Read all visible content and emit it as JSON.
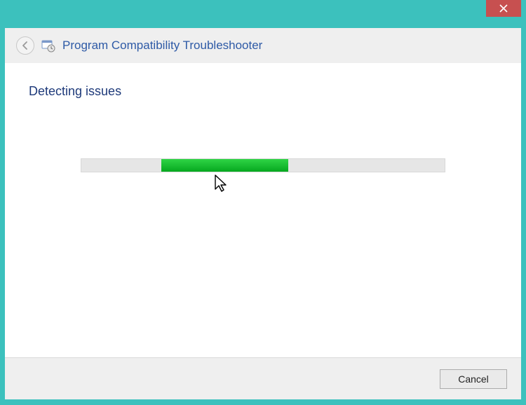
{
  "window": {
    "close_icon": "close",
    "accent_color": "#3cc1bd"
  },
  "header": {
    "title": "Program Compatibility Troubleshooter"
  },
  "page": {
    "heading": "Detecting issues"
  },
  "progress": {
    "indeterminate": true,
    "segment_start_pct": 22,
    "segment_width_pct": 35
  },
  "footer": {
    "cancel_label": "Cancel"
  }
}
